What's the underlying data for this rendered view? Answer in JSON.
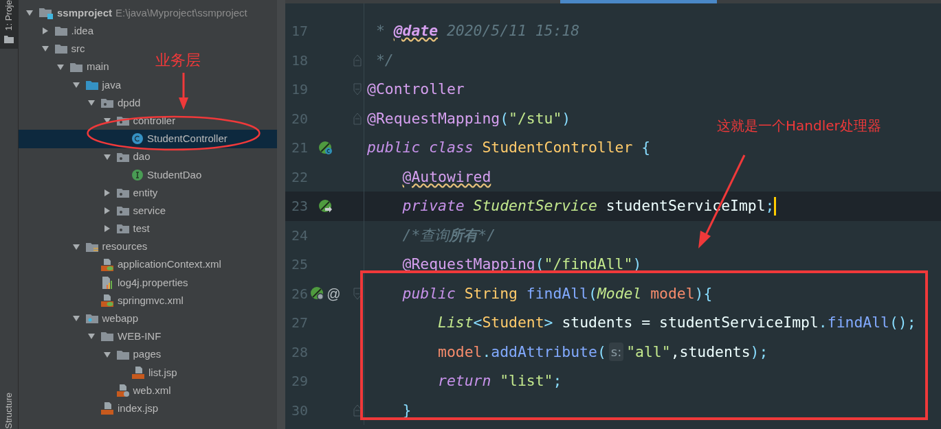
{
  "side_tabs": [
    {
      "label": "1: Proje",
      "selected": true
    },
    {
      "label": "Structure",
      "selected": false
    }
  ],
  "project_tree": [
    {
      "label": "ssmproject",
      "path": "E:\\java\\Myproject\\ssmproject",
      "kind": "project",
      "expanded": true,
      "selected": false,
      "children": [
        {
          "label": ".idea",
          "kind": "folder",
          "expanded": false,
          "selected": false
        },
        {
          "label": "src",
          "kind": "folder",
          "expanded": true,
          "selected": false,
          "children": [
            {
              "label": "main",
              "kind": "folder",
              "expanded": true,
              "selected": false,
              "children": [
                {
                  "label": "java",
                  "kind": "source-folder",
                  "expanded": true,
                  "selected": false,
                  "children": [
                    {
                      "label": "dpdd",
                      "kind": "package",
                      "expanded": true,
                      "selected": false,
                      "children": [
                        {
                          "label": "controller",
                          "kind": "package",
                          "expanded": true,
                          "selected": false,
                          "children": [
                            {
                              "label": "StudentController",
                              "kind": "class",
                              "selected": true
                            }
                          ]
                        },
                        {
                          "label": "dao",
                          "kind": "package",
                          "expanded": true,
                          "selected": false,
                          "children": [
                            {
                              "label": "StudentDao",
                              "kind": "interface",
                              "selected": false
                            }
                          ]
                        },
                        {
                          "label": "entity",
                          "kind": "package",
                          "expanded": false,
                          "selected": false
                        },
                        {
                          "label": "service",
                          "kind": "package",
                          "expanded": false,
                          "selected": false
                        },
                        {
                          "label": "test",
                          "kind": "package",
                          "expanded": false,
                          "selected": false
                        }
                      ]
                    }
                  ]
                },
                {
                  "label": "resources",
                  "kind": "resources-folder",
                  "expanded": true,
                  "selected": false,
                  "children": [
                    {
                      "label": "applicationContext.xml",
                      "kind": "spring-xml",
                      "selected": false
                    },
                    {
                      "label": "log4j.properties",
                      "kind": "properties",
                      "selected": false
                    },
                    {
                      "label": "springmvc.xml",
                      "kind": "spring-xml",
                      "selected": false
                    }
                  ]
                },
                {
                  "label": "webapp",
                  "kind": "web-folder",
                  "expanded": true,
                  "selected": false,
                  "children": [
                    {
                      "label": "WEB-INF",
                      "kind": "folder",
                      "expanded": true,
                      "selected": false,
                      "children": [
                        {
                          "label": "pages",
                          "kind": "folder",
                          "expanded": true,
                          "selected": false,
                          "children": [
                            {
                              "label": "list.jsp",
                              "kind": "jsp",
                              "selected": false
                            }
                          ]
                        },
                        {
                          "label": "web.xml",
                          "kind": "web-xml",
                          "selected": false
                        }
                      ]
                    },
                    {
                      "label": "index.jsp",
                      "kind": "jsp",
                      "selected": false
                    }
                  ]
                }
              ]
            }
          ]
        }
      ]
    }
  ],
  "editor": {
    "lines": [
      {
        "number": "17",
        "current": false,
        "tokens": [
          {
            "text": " * ",
            "kind": "comment"
          },
          {
            "text": "@date",
            "kind": "doc-tag"
          },
          {
            "text": " 2020/5/11 15:18",
            "kind": "comment"
          }
        ]
      },
      {
        "number": "18",
        "current": false,
        "fold": {
          "kind": "end"
        },
        "tokens": [
          {
            "text": " */",
            "kind": "comment"
          }
        ]
      },
      {
        "number": "19",
        "current": false,
        "fold": {
          "kind": "start"
        },
        "tokens": [
          {
            "text": "@Controller",
            "kind": "annotation"
          }
        ]
      },
      {
        "number": "20",
        "current": false,
        "fold": {
          "kind": "end"
        },
        "tokens": [
          {
            "text": "@RequestMapping",
            "kind": "annotation"
          },
          {
            "text": "(",
            "kind": "punct"
          },
          {
            "text": "\"/stu\"",
            "kind": "string"
          },
          {
            "text": ")",
            "kind": "punct"
          }
        ]
      },
      {
        "number": "21",
        "current": false,
        "gutter_icon": {
          "kind": "bean-class"
        },
        "tokens": [
          {
            "text": "public class ",
            "kind": "keyword"
          },
          {
            "text": "StudentController",
            "kind": "class-name"
          },
          {
            "text": " {",
            "kind": "punct"
          }
        ]
      },
      {
        "number": "22",
        "current": false,
        "tokens": [
          {
            "text": "    @Autowired",
            "kind": "annotation-warning"
          }
        ]
      },
      {
        "number": "23",
        "current": true,
        "gutter_icon": {
          "kind": "bean-autowired"
        },
        "tokens": [
          {
            "text": "    private ",
            "kind": "keyword"
          },
          {
            "text": "StudentService",
            "kind": "type"
          },
          {
            "text": " studentServiceImpl",
            "kind": "plain"
          },
          {
            "text": ";",
            "kind": "punct"
          }
        ]
      },
      {
        "number": "24",
        "current": false,
        "tokens": [
          {
            "text": "    /*查询",
            "kind": "comment"
          },
          {
            "text": "所有",
            "kind": "comment-bold"
          },
          {
            "text": "*/",
            "kind": "comment"
          }
        ]
      },
      {
        "number": "25",
        "current": false,
        "tokens": [
          {
            "text": "    @RequestMapping",
            "kind": "annotation"
          },
          {
            "text": "(",
            "kind": "punct"
          },
          {
            "text": "\"/findAll\"",
            "kind": "string"
          },
          {
            "text": ")",
            "kind": "punct"
          }
        ]
      },
      {
        "number": "26",
        "current": false,
        "gutter_icon": {
          "kind": "bean-web"
        },
        "gutter_mark": "@",
        "fold": {
          "kind": "start"
        },
        "tokens": [
          {
            "text": "    public ",
            "kind": "keyword"
          },
          {
            "text": "String ",
            "kind": "class-name"
          },
          {
            "text": "findAll",
            "kind": "method"
          },
          {
            "text": "(",
            "kind": "punct"
          },
          {
            "text": "Model ",
            "kind": "type"
          },
          {
            "text": "model",
            "kind": "param"
          },
          {
            "text": "){",
            "kind": "punct"
          }
        ]
      },
      {
        "number": "27",
        "current": false,
        "tokens": [
          {
            "text": "        List",
            "kind": "type"
          },
          {
            "text": "<",
            "kind": "punct"
          },
          {
            "text": "Student",
            "kind": "class-name"
          },
          {
            "text": ">",
            "kind": "punct"
          },
          {
            "text": " students = studentServiceImpl",
            "kind": "plain"
          },
          {
            "text": ".",
            "kind": "punct"
          },
          {
            "text": "findAll",
            "kind": "method"
          },
          {
            "text": "();",
            "kind": "punct"
          }
        ]
      },
      {
        "number": "28",
        "current": false,
        "tokens": [
          {
            "text": "        model",
            "kind": "param"
          },
          {
            "text": ".",
            "kind": "punct"
          },
          {
            "text": "addAttribute",
            "kind": "method"
          },
          {
            "text": "(",
            "kind": "punct"
          },
          {
            "text": "s:",
            "kind": "hint"
          },
          {
            "text": "\"all\"",
            "kind": "string"
          },
          {
            "text": ",students",
            "kind": "plain"
          },
          {
            "text": ");",
            "kind": "punct"
          }
        ]
      },
      {
        "number": "29",
        "current": false,
        "tokens": [
          {
            "text": "        return ",
            "kind": "keyword"
          },
          {
            "text": "\"list\"",
            "kind": "string"
          },
          {
            "text": ";",
            "kind": "punct"
          }
        ]
      },
      {
        "number": "30",
        "current": false,
        "fold": {
          "kind": "end"
        },
        "tokens": [
          {
            "text": "    }",
            "kind": "punct"
          }
        ]
      }
    ]
  },
  "annotations": [
    {
      "kind": "ellipse-callout",
      "text": "业务层"
    },
    {
      "kind": "frame-callout",
      "text": "这就是一个Handler处理器"
    }
  ]
}
